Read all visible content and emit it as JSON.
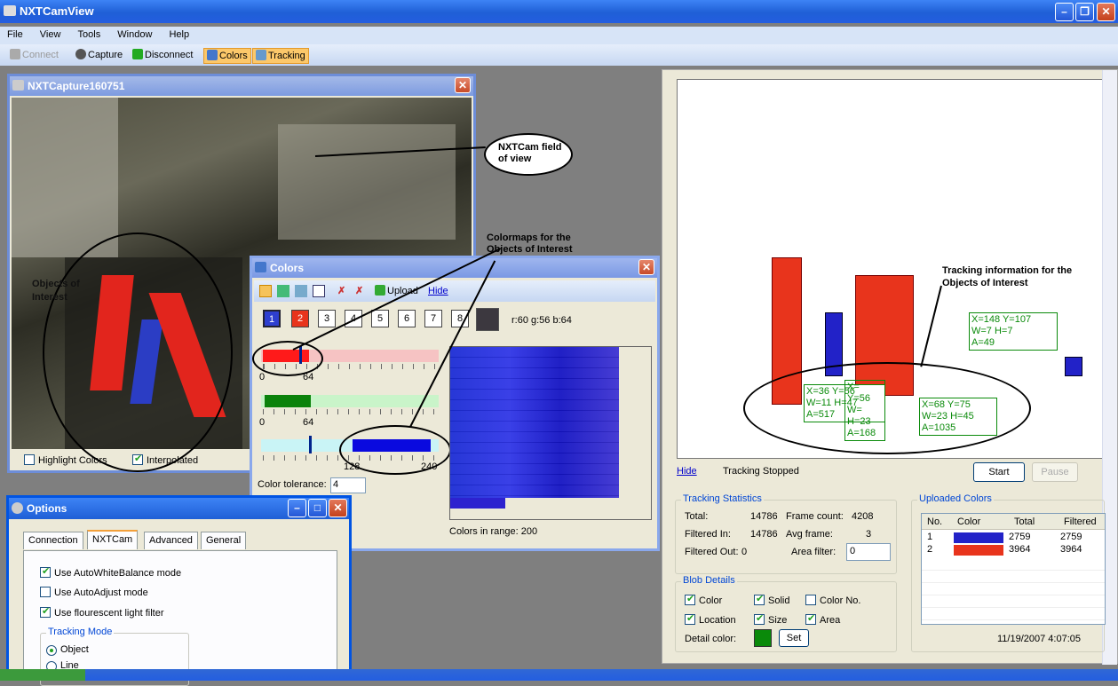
{
  "app": {
    "title": "NXTCamView",
    "menu": [
      "File",
      "View",
      "Tools",
      "Window",
      "Help"
    ],
    "toolbar": {
      "connect": "Connect",
      "capture": "Capture",
      "disconnect": "Disconnect",
      "colors": "Colors",
      "tracking": "Tracking"
    }
  },
  "capture_window": {
    "title": "NXTCapture160751",
    "highlight_label": "Highlight Colors",
    "interpolated_label": "Interpolated",
    "highlight_checked": false,
    "interpolated_checked": true
  },
  "colors_window": {
    "title": "Colors",
    "upload_label": "Upload",
    "hide_label": "Hide",
    "color_numbers": [
      "1",
      "2",
      "3",
      "4",
      "5",
      "6",
      "7",
      "8"
    ],
    "rgb_text": "r:60 g:56 b:64",
    "red_tick": "64",
    "green_tick": "64",
    "blue_tick_low": "128",
    "blue_tick_high": "240",
    "tolerance_label": "Color tolerance:",
    "tolerance_value": "4",
    "colors_in_range": "Colors in range: 200"
  },
  "options_window": {
    "title": "Options",
    "tabs": [
      "Connection",
      "NXTCam",
      "Advanced",
      "General"
    ],
    "active_tab": "NXTCam",
    "checks": [
      {
        "label": "Use AutoWhiteBalance mode",
        "checked": true
      },
      {
        "label": "Use AutoAdjust mode",
        "checked": false
      },
      {
        "label": "Use flourescent light filter",
        "checked": true
      }
    ],
    "tracking_mode_label": "Tracking Mode",
    "modes": [
      "Object",
      "Line"
    ]
  },
  "tracking_panel": {
    "hide_label": "Hide",
    "status": "Tracking Stopped",
    "start_label": "Start",
    "pause_label": "Pause",
    "stats_title": "Tracking Statistics",
    "total_label": "Total:",
    "total_value": "14786",
    "frame_count_label": "Frame count:",
    "frame_count_value": "4208",
    "filtered_in_label": "Filtered In:",
    "filtered_in_value": "14786",
    "avg_frame_label": "Avg frame:",
    "avg_frame_value": "3",
    "filtered_out_label": "Filtered Out:",
    "filtered_out_value": "0",
    "area_filter_label": "Area filter:",
    "area_filter_value": "0",
    "blob_title": "Blob Details",
    "blob_checks": [
      {
        "label": "Color",
        "checked": true
      },
      {
        "label": "Solid",
        "checked": true
      },
      {
        "label": "Color No.",
        "checked": false
      },
      {
        "label": "Location",
        "checked": true
      },
      {
        "label": "Size",
        "checked": true
      },
      {
        "label": "Area",
        "checked": true
      }
    ],
    "detail_color_label": "Detail color:",
    "set_label": "Set",
    "uploaded_title": "Uploaded Colors",
    "uploaded_headers": [
      "No.",
      "Color",
      "Total",
      "Filtered"
    ],
    "uploaded_rows": [
      {
        "no": "1",
        "color": "#2222c8",
        "total": "2759",
        "filtered": "2759"
      },
      {
        "no": "2",
        "color": "#e8341c",
        "total": "3964",
        "filtered": "3964"
      }
    ],
    "timestamp": "11/19/2007 4:07:05"
  },
  "blob_boxes": [
    {
      "lines": [
        "X=36 Y=56",
        "W=11 H=47",
        "A=517"
      ]
    },
    {
      "lines": [
        "X=  Y=56",
        "W=  H=23",
        "A=168"
      ]
    },
    {
      "lines": [
        "X=68 Y=75",
        "W=23 H=45",
        "A=1035"
      ]
    },
    {
      "lines": [
        "X=148 Y=107",
        "W=7 H=7",
        "A=49"
      ]
    }
  ],
  "annotations": {
    "field_of_view": "NXTCam field of view",
    "colormaps": "Colormaps for the Objects of Interest",
    "objects": "Objects of Interest",
    "tracking_info": "Tracking information for the Objects of Interest"
  },
  "colors": {
    "accent_red": "#e8341c",
    "accent_blue": "#2222c8",
    "track_green": "#0a8a0a"
  }
}
